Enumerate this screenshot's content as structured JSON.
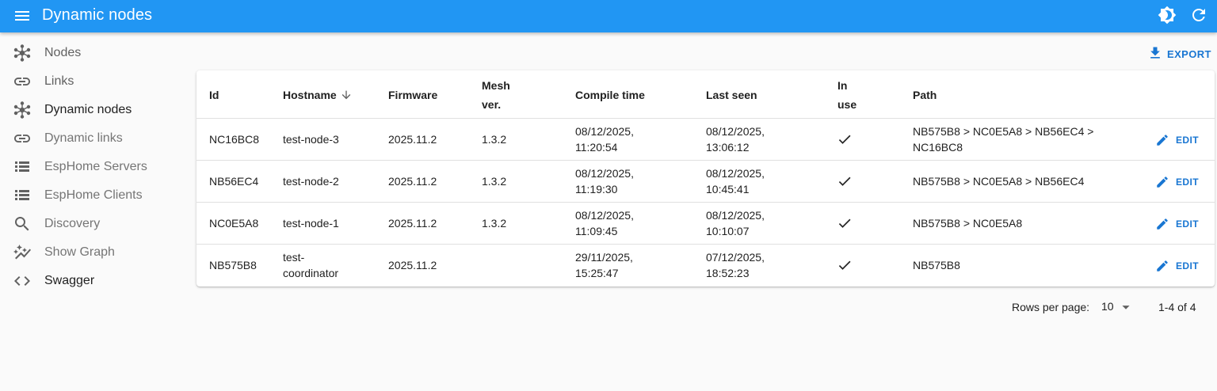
{
  "appbar": {
    "title": "Dynamic nodes",
    "color": "#2196f3",
    "icons": [
      "menu-icon",
      "brightness-icon",
      "refresh-icon"
    ]
  },
  "sidebar": {
    "items": [
      {
        "label": "Nodes",
        "icon": "hub-icon",
        "tone": "grey"
      },
      {
        "label": "Links",
        "icon": "link-icon",
        "tone": "grey"
      },
      {
        "label": "Dynamic nodes",
        "icon": "hub-icon",
        "tone": "dark"
      },
      {
        "label": "Dynamic links",
        "icon": "link-icon",
        "tone": "grey"
      },
      {
        "label": "EspHome Servers",
        "icon": "list-icon",
        "tone": "grey"
      },
      {
        "label": "EspHome Clients",
        "icon": "list-icon",
        "tone": "grey"
      },
      {
        "label": "Discovery",
        "icon": "search-icon",
        "tone": "grey"
      },
      {
        "label": "Show Graph",
        "icon": "auto-graph-icon",
        "tone": "grey"
      },
      {
        "label": "Swagger",
        "icon": "code-icon",
        "tone": "dark"
      }
    ]
  },
  "toolbar": {
    "export_label": "EXPORT",
    "export_icon": "download-icon"
  },
  "table": {
    "headers": {
      "id": "Id",
      "hostname": "Hostname",
      "firmware": "Firmware",
      "mesh_1": "Mesh",
      "mesh_2": "ver.",
      "compile_time": "Compile time",
      "last_seen": "Last seen",
      "in_use_1": "In",
      "in_use_2": "use",
      "path": "Path"
    },
    "sort_icon": "arrow-down-icon",
    "edit_label": "EDIT",
    "rows": [
      {
        "id": "NC16BC8",
        "hostname_1": "test-node-3",
        "hostname_2": "",
        "firmware": "2025.11.2",
        "mesh": "1.3.2",
        "compile_1": "08/12/2025,",
        "compile_2": "11:20:54",
        "seen_1": "08/12/2025,",
        "seen_2": "13:06:12",
        "in_use": true,
        "path_1": "NB575B8 > NC0E5A8 > NB56EC4 >",
        "path_2": "NC16BC8"
      },
      {
        "id": "NB56EC4",
        "hostname_1": "test-node-2",
        "hostname_2": "",
        "firmware": "2025.11.2",
        "mesh": "1.3.2",
        "compile_1": "08/12/2025,",
        "compile_2": "11:19:30",
        "seen_1": "08/12/2025,",
        "seen_2": "10:45:41",
        "in_use": true,
        "path_1": "NB575B8 > NC0E5A8 > NB56EC4",
        "path_2": ""
      },
      {
        "id": "NC0E5A8",
        "hostname_1": "test-node-1",
        "hostname_2": "",
        "firmware": "2025.11.2",
        "mesh": "1.3.2",
        "compile_1": "08/12/2025,",
        "compile_2": "11:09:45",
        "seen_1": "08/12/2025,",
        "seen_2": "10:10:07",
        "in_use": true,
        "path_1": "NB575B8 > NC0E5A8",
        "path_2": ""
      },
      {
        "id": "NB575B8",
        "hostname_1": "test-",
        "hostname_2": "coordinator",
        "firmware": "2025.11.2",
        "mesh": "",
        "compile_1": "29/11/2025,",
        "compile_2": "15:25:47",
        "seen_1": "07/12/2025,",
        "seen_2": "18:52:23",
        "in_use": true,
        "path_1": "NB575B8",
        "path_2": ""
      }
    ]
  },
  "pagination": {
    "rows_per_page_label": "Rows per page:",
    "rows_per_page_value": "10",
    "range_text": "1-4 of 4"
  }
}
